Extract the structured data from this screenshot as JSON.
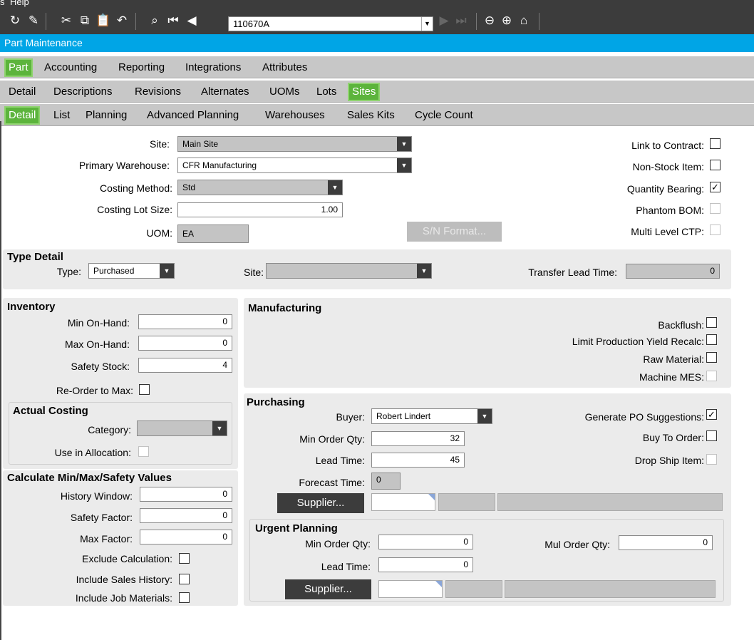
{
  "menu": {
    "help": "Help",
    "prefix": "s"
  },
  "toolbar": {
    "part_number": "110670A"
  },
  "window": {
    "title": "Part Maintenance"
  },
  "tabs_main": [
    "Part",
    "Accounting",
    "Reporting",
    "Integrations",
    "Attributes"
  ],
  "tabs_sub": [
    "Detail",
    "Descriptions",
    "Revisions",
    "Alternates",
    "UOMs",
    "Lots",
    "Sites"
  ],
  "tabs_sites": [
    "Detail",
    "List",
    "Planning",
    "Advanced Planning",
    "Warehouses",
    "Sales Kits",
    "Cycle Count"
  ],
  "site": {
    "site_label": "Site:",
    "site_value": "Main Site",
    "primary_wh_label": "Primary Warehouse:",
    "primary_wh_value": "CFR Manufacturing",
    "costing_method_label": "Costing Method:",
    "costing_method_value": "Std",
    "costing_lot_label": "Costing Lot Size:",
    "costing_lot_value": "1.00",
    "uom_label": "UOM:",
    "uom_value": "EA",
    "sn_format": "S/N Format...",
    "link_contract": "Link to Contract:",
    "non_stock": "Non-Stock Item:",
    "qty_bearing": "Quantity Bearing:",
    "phantom_bom": "Phantom BOM:",
    "multi_ctp": "Multi Level CTP:"
  },
  "type_detail": {
    "title": "Type Detail",
    "type_label": "Type:",
    "type_value": "Purchased",
    "site_label": "Site:",
    "site_value": "",
    "transfer_label": "Transfer Lead Time:",
    "transfer_value": "0"
  },
  "inventory": {
    "title": "Inventory",
    "min_label": "Min On-Hand:",
    "min_value": "0",
    "max_label": "Max On-Hand:",
    "max_value": "0",
    "safety_label": "Safety Stock:",
    "safety_value": "4",
    "reorder_label": "Re-Order to Max:"
  },
  "actual_costing": {
    "title": "Actual Costing",
    "category_label": "Category:",
    "category_value": "",
    "use_alloc_label": "Use in Allocation:"
  },
  "calc": {
    "title": "Calculate Min/Max/Safety Values",
    "history_label": "History Window:",
    "history_value": "0",
    "safety_label": "Safety Factor:",
    "safety_value": "0",
    "max_label": "Max Factor:",
    "max_value": "0",
    "exclude_label": "Exclude Calculation:",
    "sales_label": "Include Sales History:",
    "job_label": "Include Job Materials:"
  },
  "manufacturing": {
    "title": "Manufacturing",
    "backflush": "Backflush:",
    "limit_yield": "Limit Production Yield Recalc:",
    "raw_material": "Raw Material:",
    "machine_mes": "Machine MES:"
  },
  "purchasing": {
    "title": "Purchasing",
    "buyer_label": "Buyer:",
    "buyer_value": "Robert Lindert",
    "min_label": "Min Order Qty:",
    "min_value": "32",
    "lead_label": "Lead Time:",
    "lead_value": "45",
    "forecast_label": "Forecast Time:",
    "forecast_value": "0",
    "supplier_button": "Supplier...",
    "gen_po": "Generate PO Suggestions:",
    "buy_to_order": "Buy To Order:",
    "drop_ship": "Drop Ship Item:"
  },
  "urgent": {
    "title": "Urgent Planning",
    "min_label": "Min Order Qty:",
    "min_value": "0",
    "lead_label": "Lead Time:",
    "lead_value": "0",
    "mul_label": "Mul Order Qty:",
    "mul_value": "0",
    "supplier_button": "Supplier..."
  }
}
